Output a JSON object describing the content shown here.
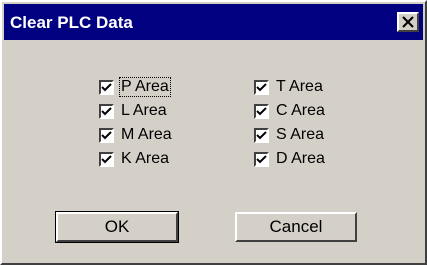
{
  "window": {
    "title": "Clear PLC Data"
  },
  "left_column": [
    {
      "label": "P Area",
      "checked": true
    },
    {
      "label": "L Area",
      "checked": true
    },
    {
      "label": "M Area",
      "checked": true
    },
    {
      "label": "K Area",
      "checked": true
    }
  ],
  "right_column": [
    {
      "label": "T Area",
      "checked": true
    },
    {
      "label": "C Area",
      "checked": true
    },
    {
      "label": "S Area",
      "checked": true
    },
    {
      "label": "D Area",
      "checked": true
    }
  ],
  "buttons": {
    "ok": "OK",
    "cancel": "Cancel"
  },
  "colors": {
    "titlebar": "#000080",
    "face": "#d4d0c8"
  },
  "icons": {
    "close": "close-icon",
    "check": "check-icon"
  }
}
